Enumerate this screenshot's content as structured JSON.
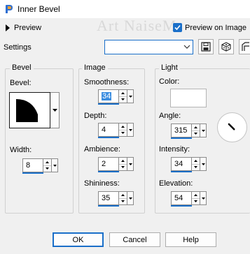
{
  "window": {
    "title": "Inner Bevel"
  },
  "preview": {
    "label": "Preview",
    "watermark": "Art NaiseM",
    "checkbox_label": "Preview on Image",
    "checked": true
  },
  "settings": {
    "label": "Settings",
    "preset_value": ""
  },
  "bevel": {
    "group_title": "Bevel",
    "bevel_label": "Bevel:",
    "width_label": "Width:",
    "width_value": "8"
  },
  "image": {
    "group_title": "Image",
    "smoothness_label": "Smoothness:",
    "smoothness_value": "34",
    "depth_label": "Depth:",
    "depth_value": "4",
    "ambience_label": "Ambience:",
    "ambience_value": "2",
    "shininess_label": "Shininess:",
    "shininess_value": "35"
  },
  "light": {
    "group_title": "Light",
    "color_label": "Color:",
    "color_value": "#ffffff",
    "angle_label": "Angle:",
    "angle_value": "315",
    "intensity_label": "Intensity:",
    "intensity_value": "34",
    "elevation_label": "Elevation:",
    "elevation_value": "54"
  },
  "buttons": {
    "ok": "OK",
    "cancel": "Cancel",
    "help": "Help"
  },
  "colors": {
    "accent": "#1a6fc9",
    "dialog_bg": "#f0f0f0"
  }
}
